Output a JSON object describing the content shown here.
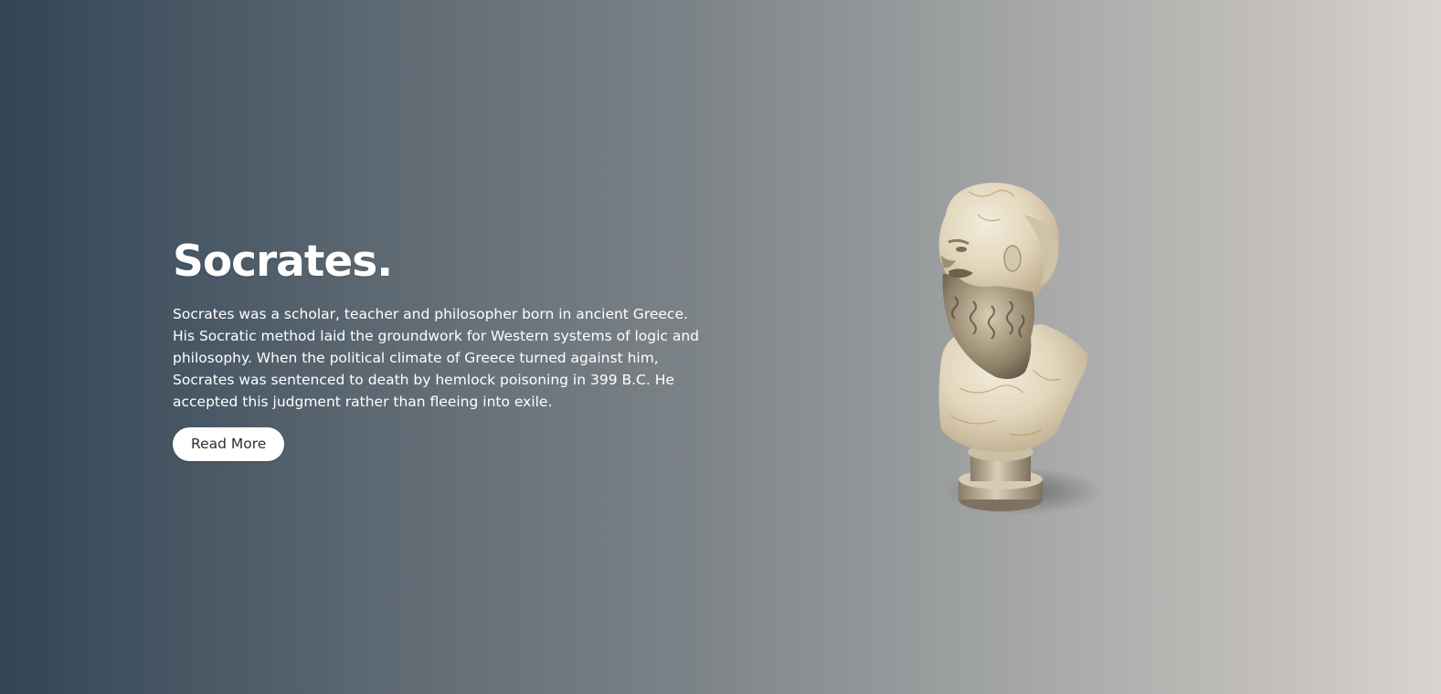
{
  "hero": {
    "title": "Socrates.",
    "description": "Socrates was a scholar, teacher and philosopher born in ancient Greece. His Socratic method laid the groundwork for Western systems of logic and philosophy. When the political climate of Greece turned against him, Socrates was sentenced to death by hemlock poisoning in 399 B.C. He accepted this judgment rather than fleeing into exile.",
    "button_label": "Read More",
    "image_icon": "marble-bust-image"
  },
  "colors": {
    "gradient_start": "#324555",
    "gradient_end": "#d8d4cf",
    "text": "#ffffff",
    "button_bg": "#ffffff",
    "button_text": "#2a2f35"
  }
}
